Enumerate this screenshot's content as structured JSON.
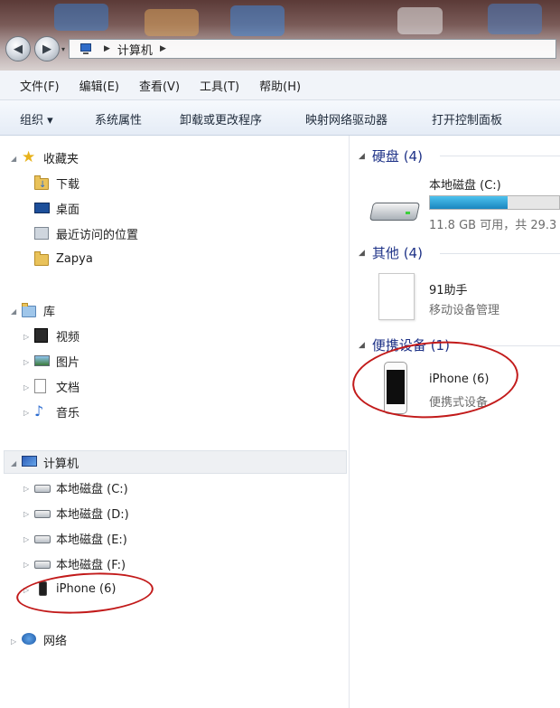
{
  "address_bar": {
    "segments": [
      "计算机"
    ]
  },
  "menu": [
    "文件(F)",
    "编辑(E)",
    "查看(V)",
    "工具(T)",
    "帮助(H)"
  ],
  "commands": [
    "组织 ▾",
    "系统属性",
    "卸载或更改程序",
    "映射网络驱动器",
    "打开控制面板"
  ],
  "nav": {
    "favorites": {
      "label": "收藏夹",
      "items": [
        "下载",
        "桌面",
        "最近访问的位置",
        "Zapya"
      ]
    },
    "libraries": {
      "label": "库",
      "items": [
        "视频",
        "图片",
        "文档",
        "音乐"
      ]
    },
    "computer": {
      "label": "计算机",
      "items": [
        "本地磁盘 (C:)",
        "本地磁盘 (D:)",
        "本地磁盘 (E:)",
        "本地磁盘 (F:)",
        "iPhone (6)"
      ]
    },
    "network": {
      "label": "网络"
    }
  },
  "content": {
    "groups": [
      {
        "title": "硬盘 (4)",
        "tiles": [
          {
            "name": "本地磁盘 (C:)",
            "detail": "11.8 GB 可用，共 29.3",
            "fill_fraction": 0.6
          }
        ]
      },
      {
        "title": "其他 (4)",
        "tiles": [
          {
            "name": "91助手",
            "detail": "移动设备管理"
          }
        ]
      },
      {
        "title": "便携设备 (1)",
        "tiles": [
          {
            "name": "iPhone (6)",
            "detail": "便携式设备"
          }
        ]
      }
    ]
  },
  "colors": {
    "group_heading": "#1e3287",
    "annotation": "#c21a1a",
    "drive_bar": "#1aa0d6"
  }
}
